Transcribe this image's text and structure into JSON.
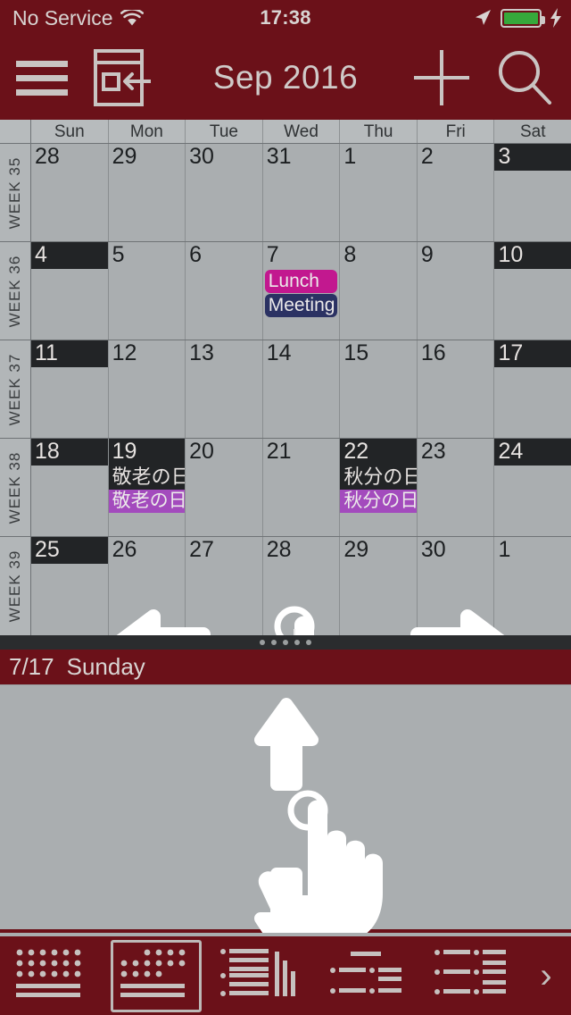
{
  "status_bar": {
    "carrier": "No Service",
    "wifi_icon": "wifi-icon",
    "time": "17:38",
    "location_icon": "location-arrow-icon",
    "battery_icon": "battery-icon",
    "charging_icon": "lightning-bolt-icon",
    "battery_color": "#36a93b"
  },
  "navbar": {
    "menu_icon": "hamburger-menu-icon",
    "today_icon": "jump-to-today-icon",
    "title": "Sep 2016",
    "add_icon": "plus-icon",
    "search_icon": "search-icon"
  },
  "calendar": {
    "weekdays": [
      "Sun",
      "Mon",
      "Tue",
      "Wed",
      "Thu",
      "Fri",
      "Sat"
    ],
    "week_label_prefix": "WEEK",
    "weeks": [
      {
        "week_label": "WEEK 35",
        "days": [
          {
            "num": "28",
            "highlight": false,
            "holiday": "",
            "events": []
          },
          {
            "num": "29",
            "highlight": false,
            "holiday": "",
            "events": []
          },
          {
            "num": "30",
            "highlight": false,
            "holiday": "",
            "events": []
          },
          {
            "num": "31",
            "highlight": false,
            "holiday": "",
            "events": []
          },
          {
            "num": "1",
            "highlight": false,
            "holiday": "",
            "events": []
          },
          {
            "num": "2",
            "highlight": false,
            "holiday": "",
            "events": []
          },
          {
            "num": "3",
            "highlight": true,
            "holiday": "",
            "events": []
          }
        ]
      },
      {
        "week_label": "WEEK 36",
        "days": [
          {
            "num": "4",
            "highlight": true,
            "holiday": "",
            "events": []
          },
          {
            "num": "5",
            "highlight": false,
            "holiday": "",
            "events": []
          },
          {
            "num": "6",
            "highlight": false,
            "holiday": "",
            "events": []
          },
          {
            "num": "7",
            "highlight": false,
            "holiday": "",
            "events": [
              {
                "title": "Lunch",
                "color": "#c2188f",
                "flat": false
              },
              {
                "title": "Meeting",
                "color": "#2b3263",
                "flat": false
              }
            ]
          },
          {
            "num": "8",
            "highlight": false,
            "holiday": "",
            "events": []
          },
          {
            "num": "9",
            "highlight": false,
            "holiday": "",
            "events": []
          },
          {
            "num": "10",
            "highlight": true,
            "holiday": "",
            "events": []
          }
        ]
      },
      {
        "week_label": "WEEK 37",
        "days": [
          {
            "num": "11",
            "highlight": true,
            "holiday": "",
            "events": []
          },
          {
            "num": "12",
            "highlight": false,
            "holiday": "",
            "events": []
          },
          {
            "num": "13",
            "highlight": false,
            "holiday": "",
            "events": []
          },
          {
            "num": "14",
            "highlight": false,
            "holiday": "",
            "events": []
          },
          {
            "num": "15",
            "highlight": false,
            "holiday": "",
            "events": []
          },
          {
            "num": "16",
            "highlight": false,
            "holiday": "",
            "events": []
          },
          {
            "num": "17",
            "highlight": true,
            "holiday": "",
            "events": []
          }
        ]
      },
      {
        "week_label": "WEEK 38",
        "days": [
          {
            "num": "18",
            "highlight": true,
            "holiday": "",
            "events": []
          },
          {
            "num": "19",
            "highlight": true,
            "holiday": "敬老の日",
            "events": [
              {
                "title": "敬老の日",
                "color": "#a34bbd",
                "flat": true
              }
            ]
          },
          {
            "num": "20",
            "highlight": false,
            "holiday": "",
            "events": []
          },
          {
            "num": "21",
            "highlight": false,
            "holiday": "",
            "events": []
          },
          {
            "num": "22",
            "highlight": true,
            "holiday": "秋分の日",
            "events": [
              {
                "title": "秋分の日",
                "color": "#a34bbd",
                "flat": true
              }
            ]
          },
          {
            "num": "23",
            "highlight": false,
            "holiday": "",
            "events": []
          },
          {
            "num": "24",
            "highlight": true,
            "holiday": "",
            "events": []
          }
        ]
      },
      {
        "week_label": "WEEK 39",
        "days": [
          {
            "num": "25",
            "highlight": true,
            "holiday": "",
            "events": []
          },
          {
            "num": "26",
            "highlight": false,
            "holiday": "",
            "events": []
          },
          {
            "num": "27",
            "highlight": false,
            "holiday": "",
            "events": []
          },
          {
            "num": "28",
            "highlight": false,
            "holiday": "",
            "events": []
          },
          {
            "num": "29",
            "highlight": false,
            "holiday": "",
            "events": []
          },
          {
            "num": "30",
            "highlight": false,
            "holiday": "",
            "events": []
          },
          {
            "num": "1",
            "highlight": false,
            "holiday": "",
            "events": []
          }
        ]
      }
    ],
    "gesture": {
      "type": "horizontal-swipe",
      "left_arrow_icon": "arrow-left-icon",
      "right_arrow_icon": "arrow-right-icon",
      "hand_icon": "tap-hand-icon"
    }
  },
  "drag_handle": {
    "dots": 5
  },
  "day_panel": {
    "date": "7/17",
    "weekday": "Sunday",
    "gesture": {
      "type": "vertical-swipe",
      "up_arrow_icon": "arrow-up-icon",
      "down_arrow_icon": "arrow-down-icon",
      "hand_icon": "tap-hand-icon"
    }
  },
  "toolbar": {
    "selected_index": 1,
    "items": [
      {
        "name": "year-view",
        "icon": "year-grid-icon"
      },
      {
        "name": "month-view",
        "icon": "month-grid-icon"
      },
      {
        "name": "week-view",
        "icon": "week-list-icon"
      },
      {
        "name": "day-view",
        "icon": "day-list-icon"
      },
      {
        "name": "list-view",
        "icon": "agenda-list-icon"
      }
    ],
    "more_label": "›"
  },
  "colors": {
    "brand": "#6b1119",
    "grid_bg": "#aaaeb0",
    "header_bg": "#b7bbbd",
    "weekend_dark": "#222426",
    "holiday_purple": "#a34bbd",
    "event_magenta": "#c2188f",
    "event_navy": "#2b3263"
  }
}
